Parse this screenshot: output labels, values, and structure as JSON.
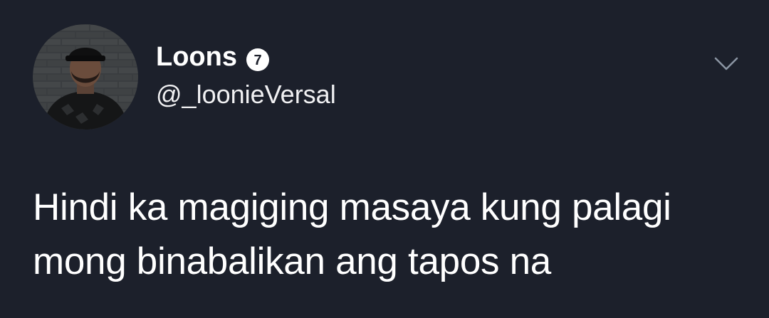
{
  "author": {
    "name": "Loons",
    "handle": "@_loonieVersal",
    "verified_badge_text": "7"
  },
  "tweet": {
    "text_lines": [
      "Hindi ka magiging masaya kung palagi",
      "mong binabalikan ang tapos na"
    ]
  },
  "icons": {
    "verified": "verified-badge-icon",
    "menu": "chevron-down-icon"
  },
  "colors": {
    "background": "#1c202b",
    "text": "#ffffff",
    "chevron": "#8b95a3"
  }
}
